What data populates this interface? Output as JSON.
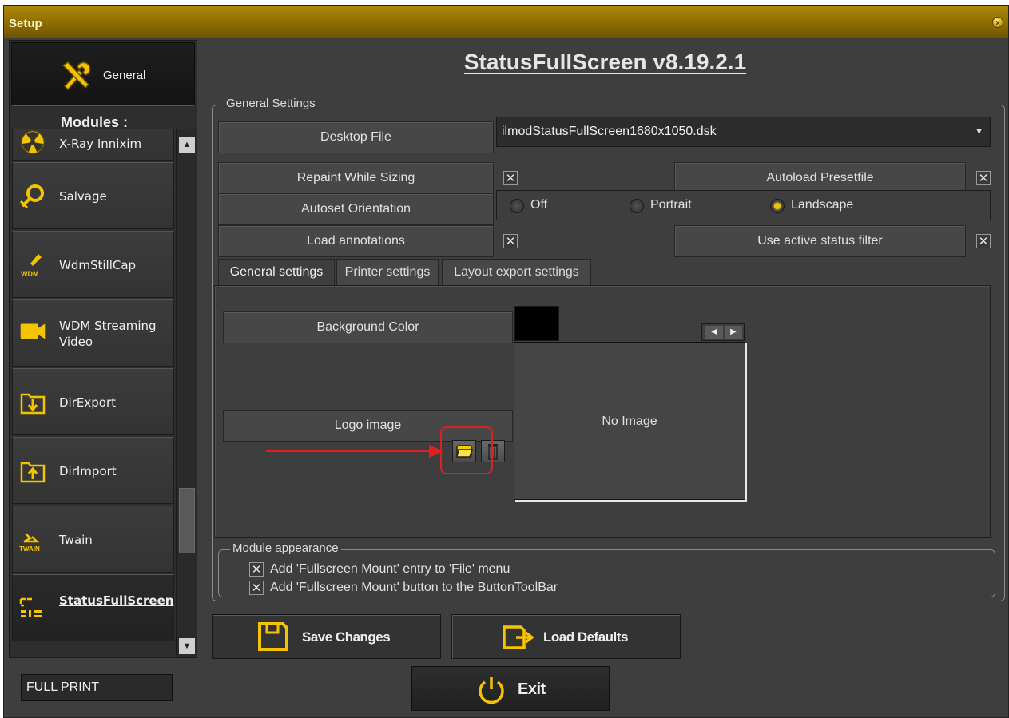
{
  "window": {
    "title": "Setup",
    "close_icon": "close-icon"
  },
  "sidebar": {
    "general_label": "General",
    "modules_label": "Modules :",
    "modules": [
      {
        "label": "X-Ray Innixim",
        "icon": "radiation-icon"
      },
      {
        "label": "Salvage",
        "icon": "lifebuoy-icon"
      },
      {
        "label": "WdmStillCap",
        "icon": "wdm-camera-icon"
      },
      {
        "label": "WDM Streaming Video",
        "icon": "video-camera-icon"
      },
      {
        "label": "DirExport",
        "icon": "folder-export-icon"
      },
      {
        "label": "DirImport",
        "icon": "folder-import-icon"
      },
      {
        "label": "Twain",
        "icon": "twain-icon"
      },
      {
        "label": "StatusFullScreen",
        "icon": "statusfullscreen-icon",
        "selected": true
      }
    ]
  },
  "main": {
    "title": "StatusFullScreen v8.19.2.1",
    "general_settings_legend": "General Settings",
    "desktop_file_label": "Desktop File",
    "desktop_file_value": "ilmodStatusFullScreen1680x1050.dsk",
    "repaint_label": "Repaint While Sizing",
    "repaint_checked": "✕",
    "autoload_label": "Autoload Presetfile",
    "autoload_checked": "✕",
    "autoset_label": "Autoset Orientation",
    "orientation_options": [
      "Off",
      "Portrait",
      "Landscape"
    ],
    "orientation_selected": "Landscape",
    "annotations_label": "Load annotations",
    "annotations_checked": "✕",
    "status_filter_label": "Use active status filter",
    "status_filter_checked": "✕",
    "tabs": [
      "General settings",
      "Printer settings",
      "Layout export settings"
    ],
    "active_tab": "General settings",
    "background_color_label": "Background Color",
    "background_color_value": "#000000",
    "logo_image_label": "Logo image",
    "no_image_text": "No Image",
    "module_appearance_legend": "Module appearance",
    "appearance_options": [
      {
        "label": "Add 'Fullscreen Mount' entry to 'File' menu",
        "checked": "✕"
      },
      {
        "label": "Add 'Fullscreen Mount' button to the ButtonToolBar",
        "checked": "✕"
      }
    ]
  },
  "actions": {
    "save_label": "Save Changes",
    "defaults_label": "Load Defaults",
    "exit_label": "Exit"
  },
  "status": {
    "mode": "FULL PRINT"
  },
  "colors": {
    "accent": "#f2c200",
    "highlight": "#e02020",
    "titlebar": "#9a7a00"
  }
}
